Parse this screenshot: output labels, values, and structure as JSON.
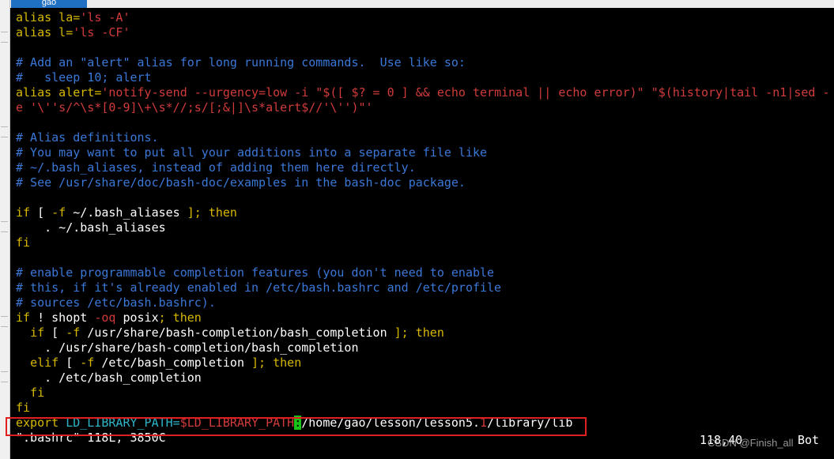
{
  "window": {
    "tab_label": "gao"
  },
  "lines": [
    [
      {
        "t": "alias la=",
        "c": "y"
      },
      {
        "t": "'ls -A'",
        "c": "r"
      }
    ],
    [
      {
        "t": "alias l=",
        "c": "y"
      },
      {
        "t": "'ls -CF'",
        "c": "r"
      }
    ],
    [],
    [
      {
        "t": "# Add an \"alert\" alias for long running commands.  Use like so:",
        "c": "b"
      }
    ],
    [
      {
        "t": "#   sleep 10; alert",
        "c": "b"
      }
    ],
    [
      {
        "t": "alias alert=",
        "c": "y"
      },
      {
        "t": "'notify-send --urgency=low -i \"$([ $? = 0 ] && echo terminal || echo error)\" \"$(history|tail -n1|sed -",
        "c": "r"
      }
    ],
    [
      {
        "t": "e '\\''s/^\\s*[0-9]\\+\\s*//;s/[;&|]\\s*alert$//'\\'')\"'",
        "c": "r"
      }
    ],
    [],
    [
      {
        "t": "# Alias definitions.",
        "c": "b"
      }
    ],
    [
      {
        "t": "# You may want to put all your additions into a separate file like",
        "c": "b"
      }
    ],
    [
      {
        "t": "# ~/.bash_aliases, instead of adding them here directly.",
        "c": "b"
      }
    ],
    [
      {
        "t": "# See /usr/share/doc/bash-doc/examples in the bash-doc package.",
        "c": "b"
      }
    ],
    [],
    [
      {
        "t": "if",
        "c": "y"
      },
      {
        "t": " [ ",
        "c": "w"
      },
      {
        "t": "-f",
        "c": "y"
      },
      {
        "t": " ~/.bash_aliases ",
        "c": "w"
      },
      {
        "t": "];",
        "c": "y"
      },
      {
        "t": " then",
        "c": "y"
      }
    ],
    [
      {
        "t": "    . ~/.bash_aliases",
        "c": "w"
      }
    ],
    [
      {
        "t": "fi",
        "c": "y"
      }
    ],
    [],
    [
      {
        "t": "# enable programmable completion features (you don't need to enable",
        "c": "b"
      }
    ],
    [
      {
        "t": "# this, if it's already enabled in /etc/bash.bashrc and /etc/profile",
        "c": "b"
      }
    ],
    [
      {
        "t": "# sources /etc/bash.bashrc).",
        "c": "b"
      }
    ],
    [
      {
        "t": "if",
        "c": "y"
      },
      {
        "t": " ! ",
        "c": "w"
      },
      {
        "t": "shopt",
        "c": "w"
      },
      {
        "t": " -oq",
        "c": "r"
      },
      {
        "t": " posix",
        "c": "w"
      },
      {
        "t": ";",
        "c": "y"
      },
      {
        "t": " then",
        "c": "y"
      }
    ],
    [
      {
        "t": "  ",
        "c": "w"
      },
      {
        "t": "if",
        "c": "y"
      },
      {
        "t": " [ ",
        "c": "w"
      },
      {
        "t": "-f",
        "c": "y"
      },
      {
        "t": " /usr/share/bash-completion/bash_completion ",
        "c": "w"
      },
      {
        "t": "];",
        "c": "y"
      },
      {
        "t": " then",
        "c": "y"
      }
    ],
    [
      {
        "t": "    . /usr/share/bash-completion/bash_completion",
        "c": "w"
      }
    ],
    [
      {
        "t": "  ",
        "c": "w"
      },
      {
        "t": "elif",
        "c": "y"
      },
      {
        "t": " [ ",
        "c": "w"
      },
      {
        "t": "-f",
        "c": "y"
      },
      {
        "t": " /etc/bash_completion ",
        "c": "w"
      },
      {
        "t": "];",
        "c": "y"
      },
      {
        "t": " then",
        "c": "y"
      }
    ],
    [
      {
        "t": "    . /etc/bash_completion",
        "c": "w"
      }
    ],
    [
      {
        "t": "  fi",
        "c": "y"
      }
    ],
    [
      {
        "t": "fi",
        "c": "y"
      }
    ],
    [
      {
        "t": "export",
        "c": "y"
      },
      {
        "t": " LD_LIBRARY_PATH=",
        "c": "g"
      },
      {
        "t": "$LD_LIBRARY_PATH",
        "c": "r"
      },
      {
        "t": ":",
        "c": "cur"
      },
      {
        "t": "/home/gao/lesson/lesson5.",
        "c": "w"
      },
      {
        "t": "1",
        "c": "r"
      },
      {
        "t": "/library/lib",
        "c": "w"
      }
    ],
    [
      {
        "t": "\".bashrc\" 118L, 3850C",
        "c": "w"
      }
    ]
  ],
  "status": {
    "position": "118,40",
    "scroll": "Bot"
  },
  "watermark": "CSDN @Finish_all"
}
